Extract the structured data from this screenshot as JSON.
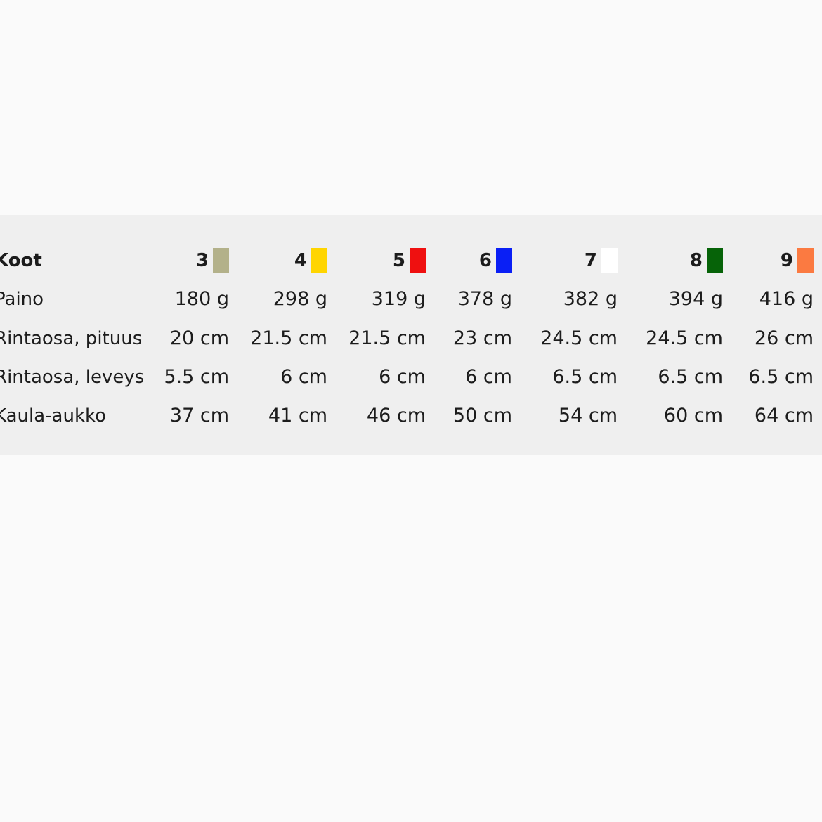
{
  "table": {
    "header_label": "Koot",
    "sizes": [
      {
        "label": "3",
        "color": "#b3b18a"
      },
      {
        "label": "4",
        "color": "#ffd500"
      },
      {
        "label": "5",
        "color": "#ef1010"
      },
      {
        "label": "6",
        "color": "#0a1ff5"
      },
      {
        "label": "7",
        "color": "#ffffff"
      },
      {
        "label": "8",
        "color": "#066308"
      },
      {
        "label": "9",
        "color": "#fb7a41"
      }
    ],
    "rows": [
      {
        "label": "Paino",
        "values": [
          "180 g",
          "298 g",
          "319 g",
          "378 g",
          "382 g",
          "394 g",
          "416 g"
        ]
      },
      {
        "label": "Rintaosa, pituus",
        "values": [
          "20 cm",
          "21.5 cm",
          "21.5 cm",
          "23 cm",
          "24.5 cm",
          "24.5 cm",
          "26 cm"
        ]
      },
      {
        "label": "Rintaosa, leveys",
        "values": [
          "5.5 cm",
          "6 cm",
          "6 cm",
          "6 cm",
          "6.5 cm",
          "6.5 cm",
          "6.5 cm"
        ]
      },
      {
        "label": "Kaula-aukko",
        "values": [
          "37 cm",
          "41 cm",
          "46 cm",
          "50 cm",
          "54 cm",
          "60 cm",
          "64 cm"
        ]
      }
    ]
  }
}
